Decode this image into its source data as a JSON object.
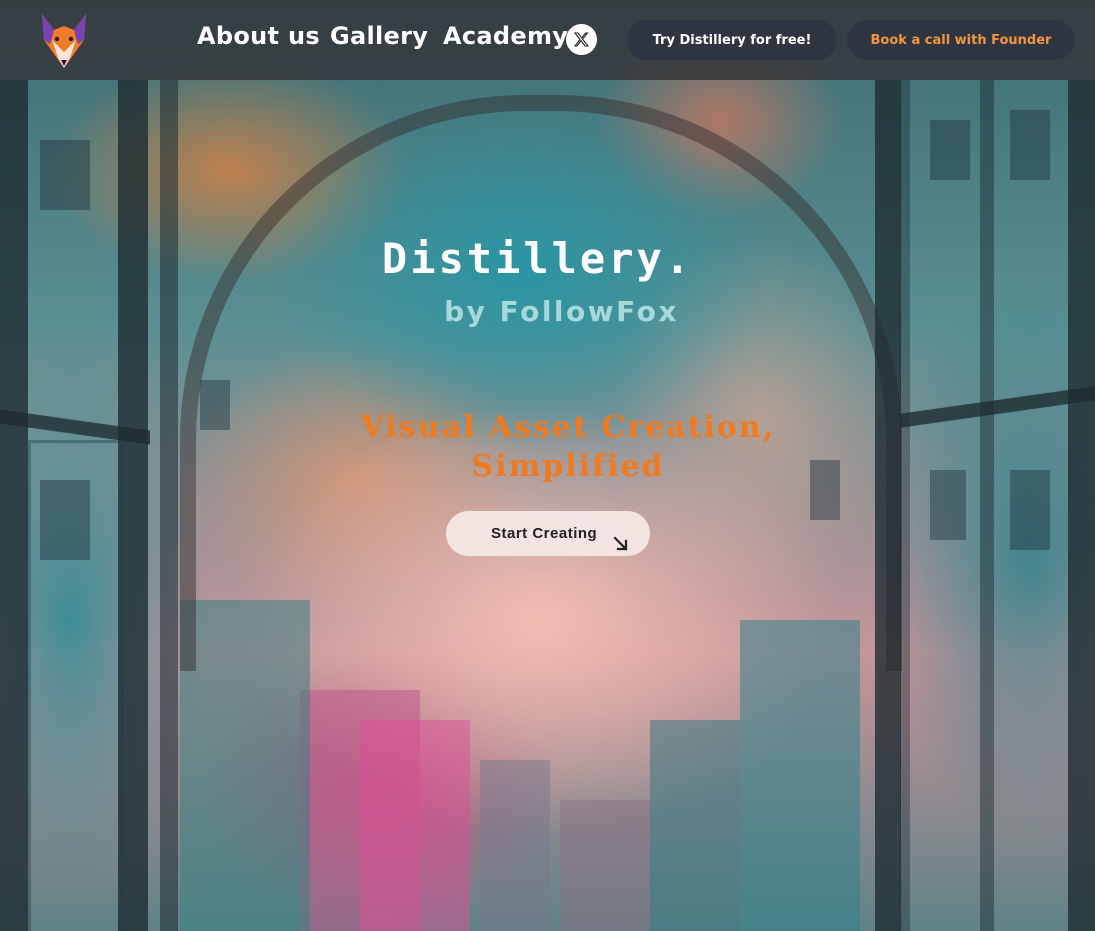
{
  "nav": {
    "links": [
      {
        "label": "About us"
      },
      {
        "label": "Gallery"
      },
      {
        "label": "Academy"
      }
    ],
    "social_icon": "x-twitter-icon",
    "try_label": "Try Distillery for free!",
    "book_label": "Book a call with Founder"
  },
  "hero": {
    "title": "Distillery.",
    "subtitle": "by FollowFox",
    "tagline_line1": "Visual Asset Creation,",
    "tagline_line2": "Simplified",
    "cta_label": "Start Creating",
    "cta_icon": "arrow-down-right-icon"
  },
  "colors": {
    "accent_orange": "#f07a1f",
    "nav_bg": "#343438",
    "pill_bg": "#2f3540",
    "subtitle": "#a8d9da"
  }
}
